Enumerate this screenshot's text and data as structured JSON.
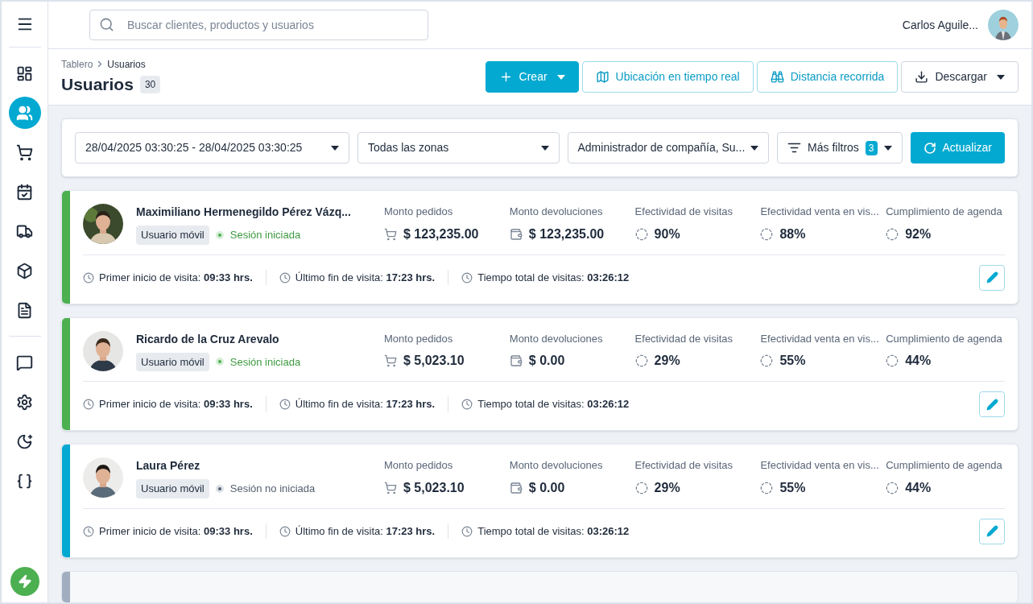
{
  "sidebar": {
    "main_items": [
      {
        "selected": false
      },
      {
        "selected": true
      },
      {
        "selected": false
      },
      {
        "selected": false
      },
      {
        "selected": false
      },
      {
        "selected": false
      },
      {
        "selected": false
      }
    ],
    "tool_items": [
      {
        "selected": false
      },
      {
        "selected": false
      },
      {
        "selected": false
      },
      {
        "selected": false
      }
    ]
  },
  "topbar": {
    "search": {
      "placeholder": "Buscar clientes, productos y usuarios"
    },
    "user_name": "Carlos Aguile..."
  },
  "header": {
    "breadcrumb": [
      "Tablero",
      "Usuarios"
    ],
    "title": "Usuarios",
    "count": "30",
    "actions": [
      {
        "label": "Crear",
        "kind": "primary"
      },
      {
        "label": "Ubicación en tiempo real",
        "kind": "outline"
      },
      {
        "label": "Distancia recorrida",
        "kind": "outline"
      },
      {
        "label": "Descargar",
        "kind": "menu"
      }
    ]
  },
  "filters": {
    "selects": [
      "28/04/2025 03:30:25 - 28/04/2025 03:30:25",
      "Todas las zonas",
      "Administrador de compañía, Su..."
    ],
    "more_filters": {
      "label": "Más filtros",
      "count": "3"
    },
    "refresh": "Actualizar"
  },
  "users": [
    {
      "name": "Maximiliano Hermenegildo Pérez Vázq...",
      "role": "Usuario móvil",
      "status": "Sesión iniciada",
      "session_active": true,
      "color": "#4caf50",
      "metrics": [
        {
          "label": "Monto pedidos",
          "value": "$ 123,235.00"
        },
        {
          "label": "Monto devoluciones",
          "value": "$ 123,235.00"
        },
        {
          "label": "Efectividad de visitas",
          "value": "90%"
        },
        {
          "label": "Efectividad venta en vis...",
          "value": "88%"
        },
        {
          "label": "Cumplimiento de agenda",
          "value": "92%"
        }
      ],
      "times": [
        {
          "label": "Primer inicio de visita:",
          "value": "09:33 hrs."
        },
        {
          "label": "Último fin de visita:",
          "value": "17:23 hrs."
        },
        {
          "label": "Tiempo total de visitas:",
          "value": "03:26:12"
        }
      ]
    },
    {
      "name": "Ricardo de la Cruz Arevalo",
      "role": "Usuario móvil",
      "status": "Sesión iniciada",
      "session_active": true,
      "color": "#4caf50",
      "metrics": [
        {
          "label": "Monto pedidos",
          "value": "$ 5,023.10"
        },
        {
          "label": "Monto devoluciones",
          "value": "$ 0.00"
        },
        {
          "label": "Efectividad de visitas",
          "value": "29%"
        },
        {
          "label": "Efectividad venta en vis...",
          "value": "55%"
        },
        {
          "label": "Cumplimiento de agenda",
          "value": "44%"
        }
      ],
      "times": [
        {
          "label": "Primer inicio de visita:",
          "value": "09:33 hrs."
        },
        {
          "label": "Último fin de visita:",
          "value": "17:23 hrs."
        },
        {
          "label": "Tiempo total de visitas:",
          "value": "03:26:12"
        }
      ]
    },
    {
      "name": "Laura Pérez",
      "role": "Usuario móvil",
      "status": "Sesión no iniciada",
      "session_active": false,
      "color": "#03a9d1",
      "metrics": [
        {
          "label": "Monto pedidos",
          "value": "$ 5,023.10"
        },
        {
          "label": "Monto devoluciones",
          "value": "$ 0.00"
        },
        {
          "label": "Efectividad de visitas",
          "value": "29%"
        },
        {
          "label": "Efectividad venta en vis...",
          "value": "55%"
        },
        {
          "label": "Cumplimiento de agenda",
          "value": "44%"
        }
      ],
      "times": [
        {
          "label": "Primer inicio de visita:",
          "value": "09:33 hrs."
        },
        {
          "label": "Último fin de visita:",
          "value": "17:23 hrs."
        },
        {
          "label": "Tiempo total de visitas:",
          "value": "03:26:12"
        }
      ]
    }
  ],
  "partial_card": {
    "color": "#a0aec0"
  }
}
